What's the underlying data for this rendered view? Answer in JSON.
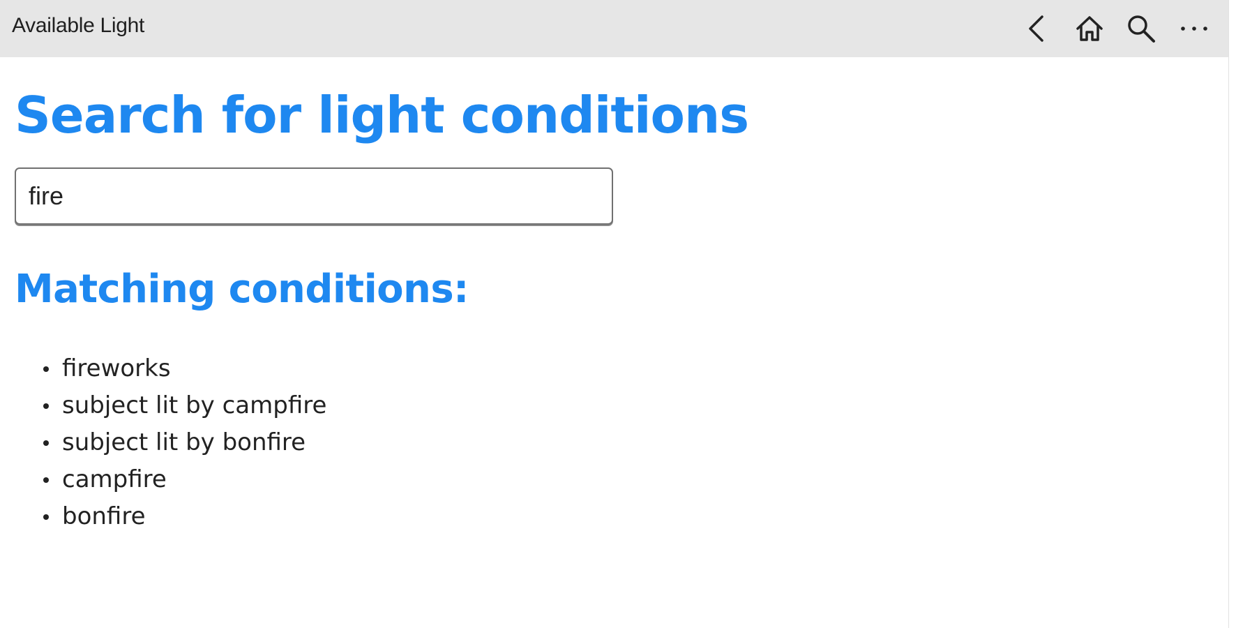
{
  "window": {
    "title": "Available Light"
  },
  "toolbar": {
    "back_icon": "chevron-left-icon",
    "home_icon": "home-icon",
    "search_icon": "search-icon",
    "more_icon": "more-horizontal-icon"
  },
  "main": {
    "heading": "Search for light conditions",
    "search": {
      "value": "fire",
      "placeholder": ""
    },
    "results_heading": "Matching conditions:",
    "results": [
      "fireworks",
      "subject lit by campfire",
      "subject lit by bonfire",
      "campfire",
      "bonfire"
    ]
  },
  "colors": {
    "accent": "#1e88f0",
    "titlebar_bg": "#e6e6e6",
    "text": "#222222"
  }
}
